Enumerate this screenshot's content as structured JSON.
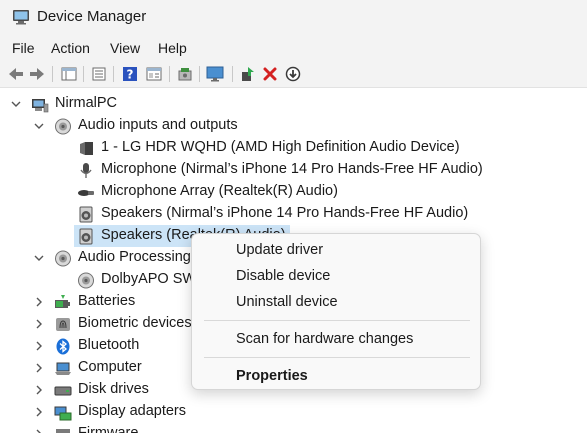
{
  "window": {
    "title": "Device Manager"
  },
  "menu": [
    "File",
    "Action",
    "View",
    "Help"
  ],
  "toolbar": [
    "back-arrow-icon",
    "forward-arrow-icon",
    "properties-grid-icon",
    "list-view-icon",
    "help-icon",
    "details-view-icon",
    "scan-hardware-icon",
    "monitor-icon",
    "update-driver-icon",
    "uninstall-icon",
    "download-icon"
  ],
  "tree": {
    "root": "NirmalPC",
    "audio_group": "Audio inputs and outputs",
    "audio_children": [
      "1 - LG HDR WQHD (AMD High Definition Audio Device)",
      "Microphone (Nirmal’s iPhone 14 Pro Hands-Free HF Audio)",
      "Microphone Array (Realtek(R) Audio)",
      "Speakers (Nirmal’s iPhone 14 Pro Hands-Free HF Audio)",
      "Speakers (Realtek(R) Audio)"
    ],
    "audio_processing": "Audio Processing",
    "audio_processing_child": "DolbyAPO SW",
    "categories": [
      "Batteries",
      "Biometric devices",
      "Bluetooth",
      "Computer",
      "Disk drives",
      "Display adapters",
      "Firmware"
    ]
  },
  "context_menu": {
    "items": [
      "Update driver",
      "Disable device",
      "Uninstall device",
      "Scan for hardware changes",
      "Properties"
    ]
  }
}
